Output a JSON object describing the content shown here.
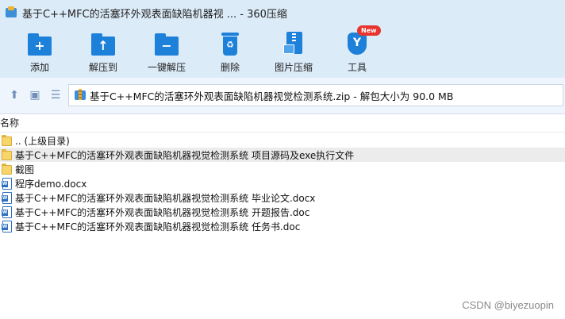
{
  "window": {
    "title": "基于C++MFC的活塞环外观表面缺陷机器视 ... - 360压缩"
  },
  "toolbar": {
    "add_label": "添加",
    "extract_label": "解压到",
    "oneclick_label": "一键解压",
    "delete_label": "删除",
    "imgcompress_label": "图片压缩",
    "tools_label": "工具",
    "new_badge": "New"
  },
  "address": {
    "text": "基于C++MFC的活塞环外观表面缺陷机器视觉检测系统.zip - 解包大小为 90.0 MB"
  },
  "columns": {
    "name": "名称"
  },
  "files": [
    {
      "name": ".. (上级目录)",
      "type": "folder"
    },
    {
      "name": "基于C++MFC的活塞环外观表面缺陷机器视觉检测系统 项目源码及exe执行文件",
      "type": "folder"
    },
    {
      "name": "截图",
      "type": "folder"
    },
    {
      "name": "程序demo.docx",
      "type": "docx"
    },
    {
      "name": "基于C++MFC的活塞环外观表面缺陷机器视觉检测系统 毕业论文.docx",
      "type": "docx"
    },
    {
      "name": "基于C++MFC的活塞环外观表面缺陷机器视觉检测系统 开题报告.doc",
      "type": "docx"
    },
    {
      "name": "基于C++MFC的活塞环外观表面缺陷机器视觉检测系统 任务书.doc",
      "type": "docx"
    }
  ],
  "watermark": "CSDN @biyezuopin",
  "colors": {
    "accent": "#1d80d9",
    "chrome": "#dcebf8",
    "badge": "#e8342e",
    "folder": "#f6d56a"
  },
  "icons": {
    "add": "folder-plus-icon",
    "extract": "folder-up-icon",
    "oneclick": "folder-minus-icon",
    "delete": "recycle-bin-icon",
    "imgcompress": "zip-image-icon",
    "tools": "shield-y-icon"
  }
}
